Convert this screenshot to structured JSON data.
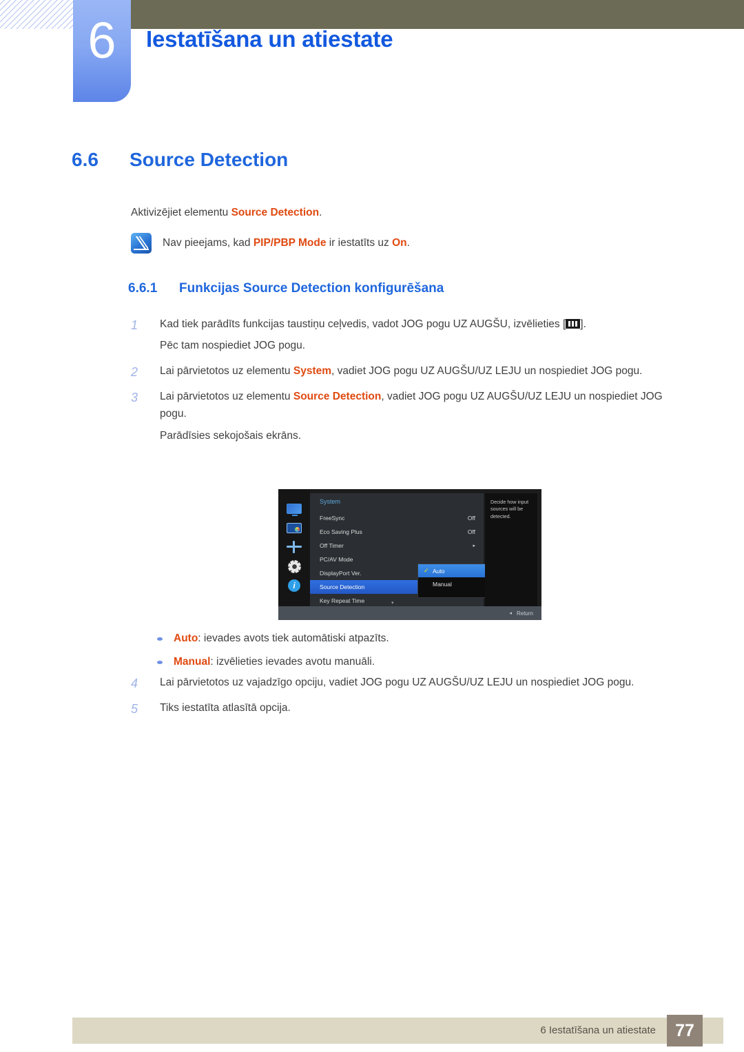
{
  "header": {
    "chapter_number": "6",
    "chapter_title": "Iestatīšana un atiestate",
    "accent_blue": "#1359df",
    "bar_color": "#6c6b55"
  },
  "section": {
    "number": "6.6",
    "title": "Source Detection",
    "intro_before": "Aktivizējiet elementu ",
    "intro_keyword": "Source Detection",
    "intro_after": "."
  },
  "note": {
    "icon": "note-pen-icon",
    "before": "Nav pieejams, kad ",
    "keyword1": "PIP/PBP Mode",
    "middle": " ir iestatīts uz ",
    "keyword2": "On",
    "after": "."
  },
  "subsection": {
    "number": "6.6.1",
    "title": "Funkcijas Source Detection konfigurēšana"
  },
  "steps": [
    {
      "num": "1",
      "lines": [
        "Kad tiek parādīts funkcijas taustiņu ceļvedis, vadot JOG pogu UZ AUGŠU, izvēlieties [",
        "].",
        "Pēc tam nospiediet JOG pogu."
      ]
    },
    {
      "num": "2",
      "before": "Lai pārvietotos uz elementu ",
      "keyword": "System",
      "after": ", vadiet JOG pogu UZ AUGŠU/UZ LEJU un nospiediet JOG pogu."
    },
    {
      "num": "3",
      "before": "Lai pārvietotos uz elementu ",
      "keyword": "Source Detection",
      "after": ", vadiet JOG pogu UZ AUGŠU/UZ LEJU un nospiediet JOG pogu.",
      "extra": "Parādīsies sekojošais ekrāns."
    }
  ],
  "osd": {
    "menu_title": "System",
    "icons": [
      "monitor-icon",
      "picture-icon",
      "move-icon",
      "gear-icon",
      "info-icon"
    ],
    "rows": [
      {
        "label": "FreeSync",
        "value": "Off"
      },
      {
        "label": "Eco Saving Plus",
        "value": "Off"
      },
      {
        "label": "Off Timer",
        "value": "▸"
      },
      {
        "label": "PC/AV Mode",
        "value": ""
      },
      {
        "label": "DisplayPort Ver.",
        "value": ""
      },
      {
        "label": "Source Detection",
        "value": "",
        "selected": true
      },
      {
        "label": "Key Repeat Time",
        "value": ""
      }
    ],
    "scroll_down": "▾",
    "submenu": [
      {
        "label": "Auto",
        "checked": true
      },
      {
        "label": "Manual",
        "checked": false
      }
    ],
    "help_text": "Decide how input sources will be detected.",
    "return_arrow": "◂",
    "return_label": "Return"
  },
  "bullets": [
    {
      "keyword": "Auto",
      "text": ": ievades avots tiek automātiski atpazīts."
    },
    {
      "keyword": "Manual",
      "text": ": izvēlieties ievades avotu manuāli."
    }
  ],
  "steps2": [
    {
      "num": "4",
      "text": "Lai pārvietotos uz vajadzīgo opciju, vadiet JOG pogu UZ AUGŠU/UZ LEJU un nospiediet JOG pogu."
    },
    {
      "num": "5",
      "text": "Tiks iestatīta atlasītā opcija."
    }
  ],
  "footer": {
    "label": "6 Iestatīšana un atiestate",
    "page_number": "77",
    "bar_color": "#ddd8c4",
    "page_box_color": "#8f8477"
  }
}
